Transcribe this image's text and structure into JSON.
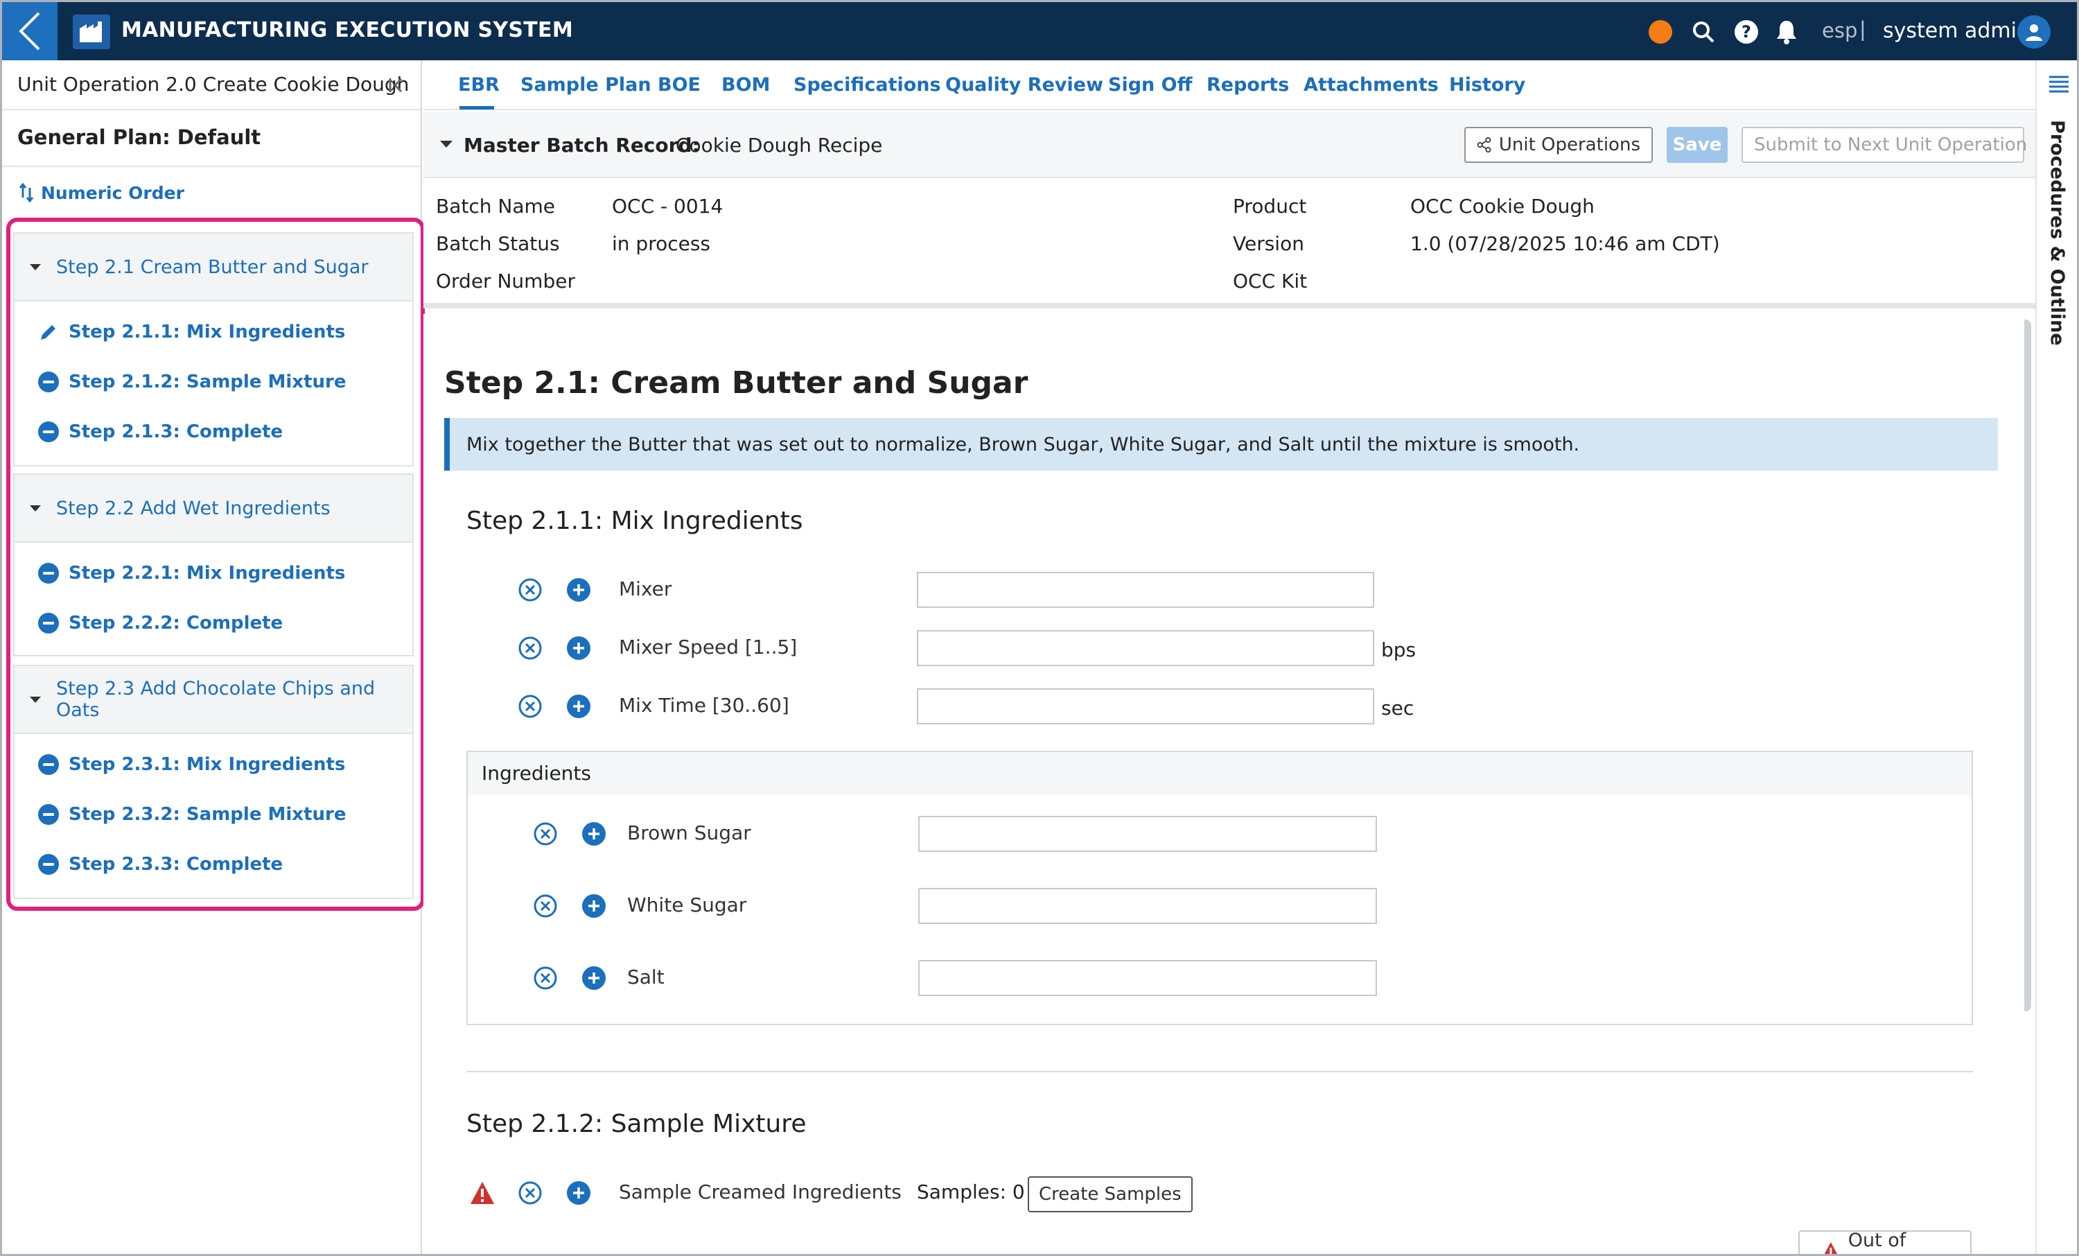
{
  "app": {
    "title": "MANUFACTURING EXECUTION SYSTEM",
    "language": "esp",
    "language_sep": "|",
    "user": "system admin",
    "status_color": "#f47d16"
  },
  "sidebar": {
    "unit_operation": "Unit Operation 2.0 Create Cookie Dough",
    "plan": "General Plan: Default",
    "order_link": "Numeric Order",
    "groups": [
      {
        "title": "Step 2.1 Cream Butter and Sugar",
        "items": [
          {
            "label": "Step 2.1.1: Mix Ingredients",
            "icon": "pencil-icon"
          },
          {
            "label": "Step 2.1.2: Sample Mixture",
            "icon": "minus-circle-icon"
          },
          {
            "label": "Step 2.1.3: Complete",
            "icon": "minus-circle-icon"
          }
        ]
      },
      {
        "title": "Step 2.2 Add Wet Ingredients",
        "items": [
          {
            "label": "Step 2.2.1: Mix Ingredients",
            "icon": "minus-circle-icon"
          },
          {
            "label": "Step 2.2.2: Complete",
            "icon": "minus-circle-icon"
          }
        ]
      },
      {
        "title": "Step 2.3 Add Chocolate Chips and Oats",
        "items": [
          {
            "label": "Step 2.3.1: Mix Ingredients",
            "icon": "minus-circle-icon"
          },
          {
            "label": "Step 2.3.2: Sample Mixture",
            "icon": "minus-circle-icon"
          },
          {
            "label": "Step 2.3.3: Complete",
            "icon": "minus-circle-icon"
          }
        ]
      }
    ]
  },
  "tabs": [
    "EBR",
    "Sample Plan",
    "BOE",
    "BOM",
    "Specifications",
    "Quality Review",
    "Sign Off",
    "Reports",
    "Attachments",
    "History"
  ],
  "active_tab": "EBR",
  "right_rail": {
    "label": "Procedures & Outline"
  },
  "mbr": {
    "label": "Master Batch Record:",
    "value": "Cookie Dough Recipe",
    "unit_ops_button": "Unit Operations",
    "save_button": "Save",
    "submit_button": "Submit to Next Unit Operation"
  },
  "batch_info": {
    "batch_name_label": "Batch Name",
    "batch_name": "OCC - 0014",
    "batch_status_label": "Batch Status",
    "batch_status": "in process",
    "order_number_label": "Order Number",
    "order_number": "",
    "product_label": "Product",
    "product": "OCC Cookie Dough",
    "version_label": "Version",
    "version": "1.0 (07/28/2025 10:46 am CDT)",
    "kit_label": "OCC Kit"
  },
  "content": {
    "step_title": "Step 2.1: Cream Butter and Sugar",
    "instruction": "Mix together the Butter that was set out to normalize, Brown Sugar, White Sugar, and Salt until the mixture is smooth.",
    "substep1": {
      "title": "Step 2.1.1: Mix Ingredients",
      "fields": [
        {
          "label": "Mixer",
          "value": "",
          "unit": ""
        },
        {
          "label": "Mixer Speed [1..5]",
          "value": "",
          "unit": "bps"
        },
        {
          "label": "Mix Time [30..60]",
          "value": "",
          "unit": "sec"
        }
      ],
      "ingredients_title": "Ingredients",
      "ingredients": [
        {
          "label": "Brown Sugar",
          "value": ""
        },
        {
          "label": "White Sugar",
          "value": ""
        },
        {
          "label": "Salt",
          "value": ""
        }
      ]
    },
    "substep2": {
      "title": "Step 2.1.2: Sample Mixture",
      "sample_label": "Sample Creamed Ingredients",
      "samples_count": "Samples: 0",
      "create_button": "Create Samples",
      "out_of_range": "Out of Range"
    }
  }
}
